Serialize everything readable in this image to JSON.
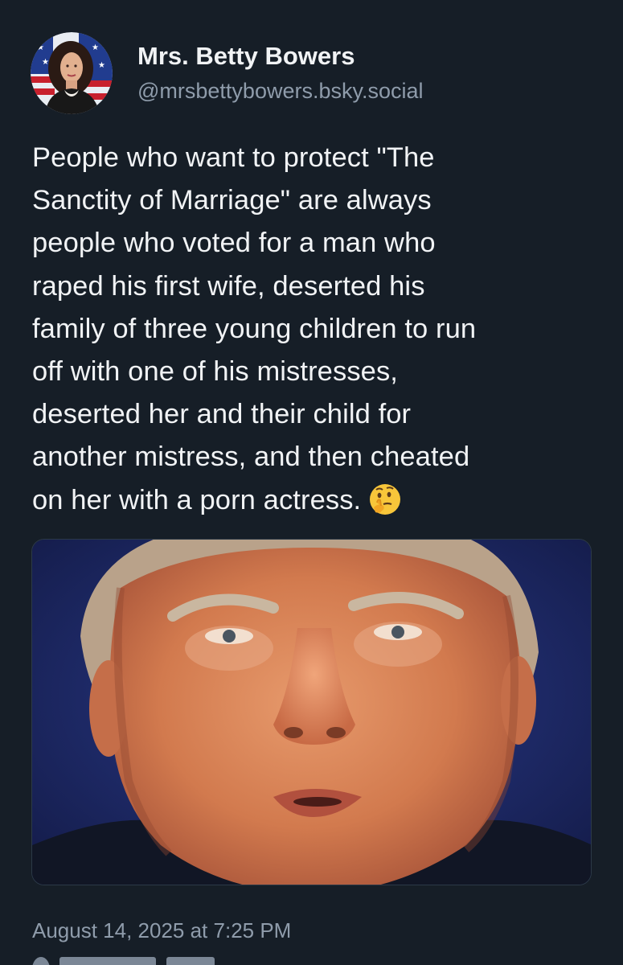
{
  "author": {
    "display_name": "Mrs. Betty Bowers",
    "handle": "@mrsbettybowers.bsky.social",
    "avatar_icon": "profile-photo"
  },
  "post": {
    "text_lines": [
      "People who want to protect \"The",
      "Sanctity of Marriage\" are always",
      "people who voted for a man who",
      "raped his first wife, deserted his",
      "family of three young children to run",
      "off with one of his mistresses,",
      "deserted her and their child for",
      "another mistress, and then cheated",
      "on her with a porn actress."
    ],
    "emoji": "thinking-face-icon",
    "timestamp": "August 14, 2025 at 7:25 PM"
  },
  "colors": {
    "background": "#161e27",
    "text_primary": "#f1f3f5",
    "text_secondary": "#8f9cab",
    "image_backdrop": "#1f2b63"
  }
}
